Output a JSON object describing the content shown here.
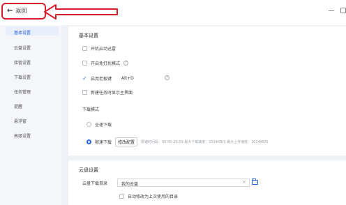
{
  "header": {
    "back_label": "返回"
  },
  "sidebar": {
    "items": [
      {
        "label": "基本设置"
      },
      {
        "label": "云盘设置"
      },
      {
        "label": "接管设置"
      },
      {
        "label": "下载设置"
      },
      {
        "label": "任务管理"
      },
      {
        "label": "提醒"
      },
      {
        "label": "悬浮窗"
      },
      {
        "label": "高级设置"
      }
    ]
  },
  "basic": {
    "title": "基本设置",
    "options": [
      {
        "label": "开机启动迅雷"
      },
      {
        "label": "开启免打扰模式"
      },
      {
        "label": "启用老板键"
      },
      {
        "label": "新建任务时显示主界面"
      }
    ],
    "hotkey": "Alt+D",
    "download_mode_title": "下载模式",
    "mode_full": "全速下载",
    "mode_limited": "限速下载",
    "modify_button": "修改配置",
    "limit_info": "限速时间段：00:00-23:59  最大下载速度：1024KB/S    最大上传速度：1024KB/S"
  },
  "cloud": {
    "title": "云盘设置",
    "dir_label": "云盘下载目录",
    "dir_value": "我的云盘",
    "auto_option": "自动修改为上次使用的目录"
  },
  "colors": {
    "accent": "#2766e0",
    "annotation": "#d81e2a"
  },
  "icons": [
    "back-arrow-icon",
    "help-icon",
    "folder-icon",
    "clear-icon",
    "minimize-icon",
    "maximize-icon",
    "check-icon"
  ]
}
